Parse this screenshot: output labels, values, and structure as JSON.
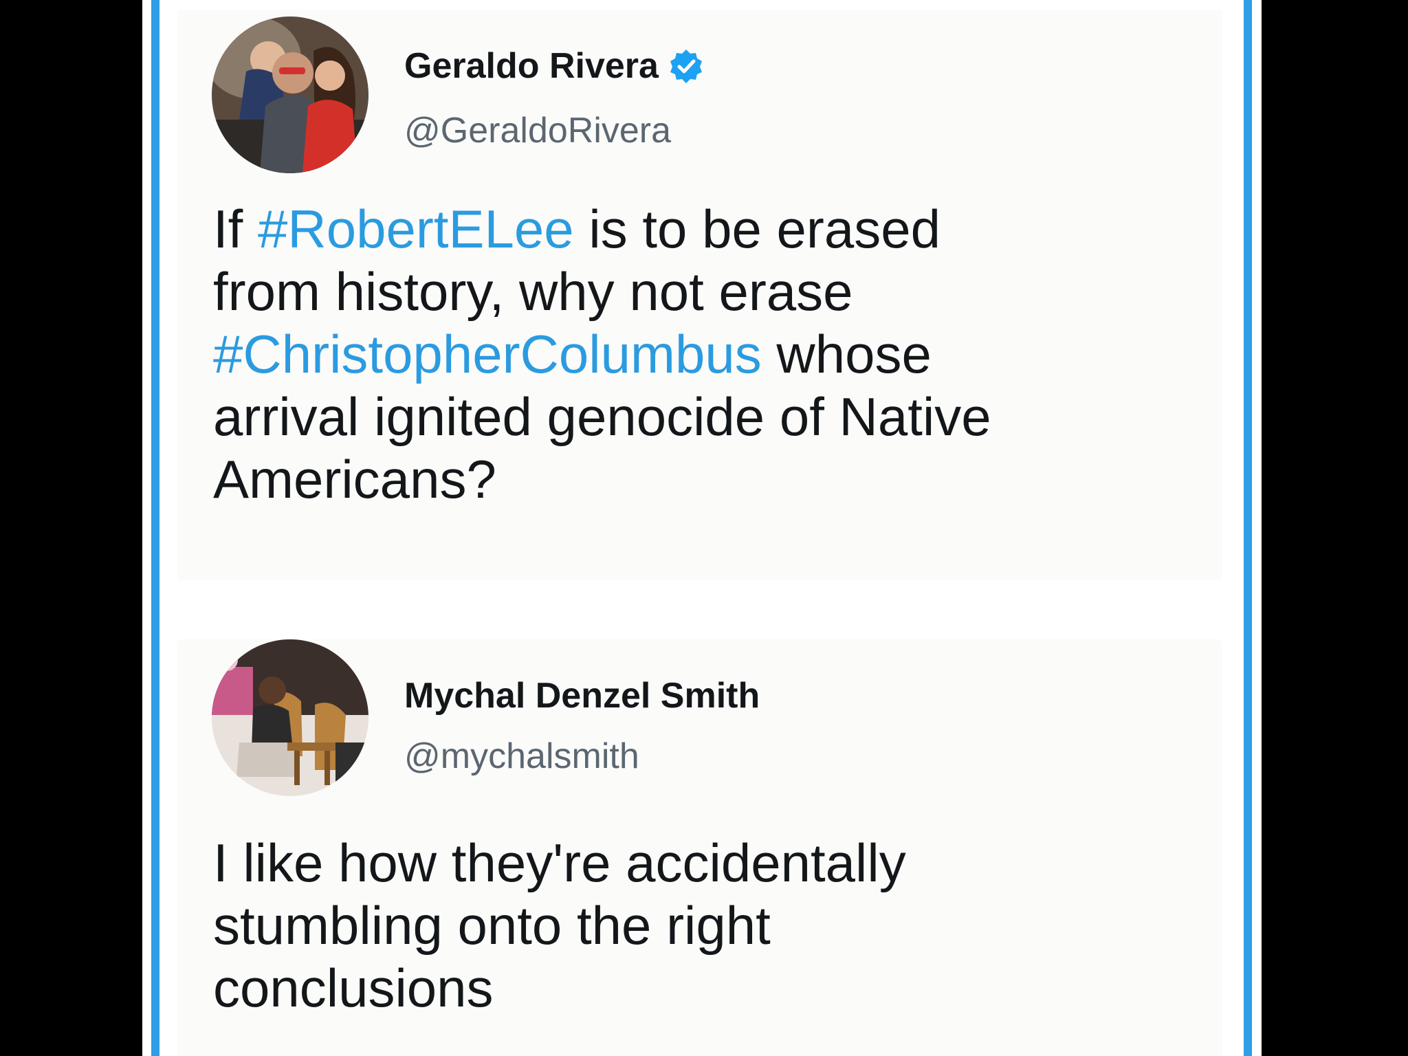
{
  "tweets": [
    {
      "display_name": "Geraldo Rivera",
      "verified": true,
      "handle": "@GeraldoRivera",
      "avatar_icon": "profile-photo-avatar",
      "text": {
        "line1_before": "If ",
        "line1_hashtag": "#RobertELee",
        "line1_after": " is to be erased",
        "line2": "from history, why not erase",
        "line3_hashtag": "#ChristopherColumbus",
        "line3_after": " whose",
        "line4": "arrival ignited genocide of Native",
        "line5": "Americans?"
      }
    },
    {
      "display_name": "Mychal Denzel Smith",
      "verified": false,
      "handle": "@mychalsmith",
      "avatar_icon": "profile-photo-avatar",
      "text": {
        "line1": "I like how they're accidentally",
        "line2": "stumbling onto the right",
        "line3": "conclusions"
      }
    }
  ],
  "colors": {
    "frame_border": "#2f9ee6",
    "hashtag": "#2b9be0",
    "verified_badge": "#1da1f2",
    "text": "#14171a",
    "handle": "#5b6670"
  }
}
